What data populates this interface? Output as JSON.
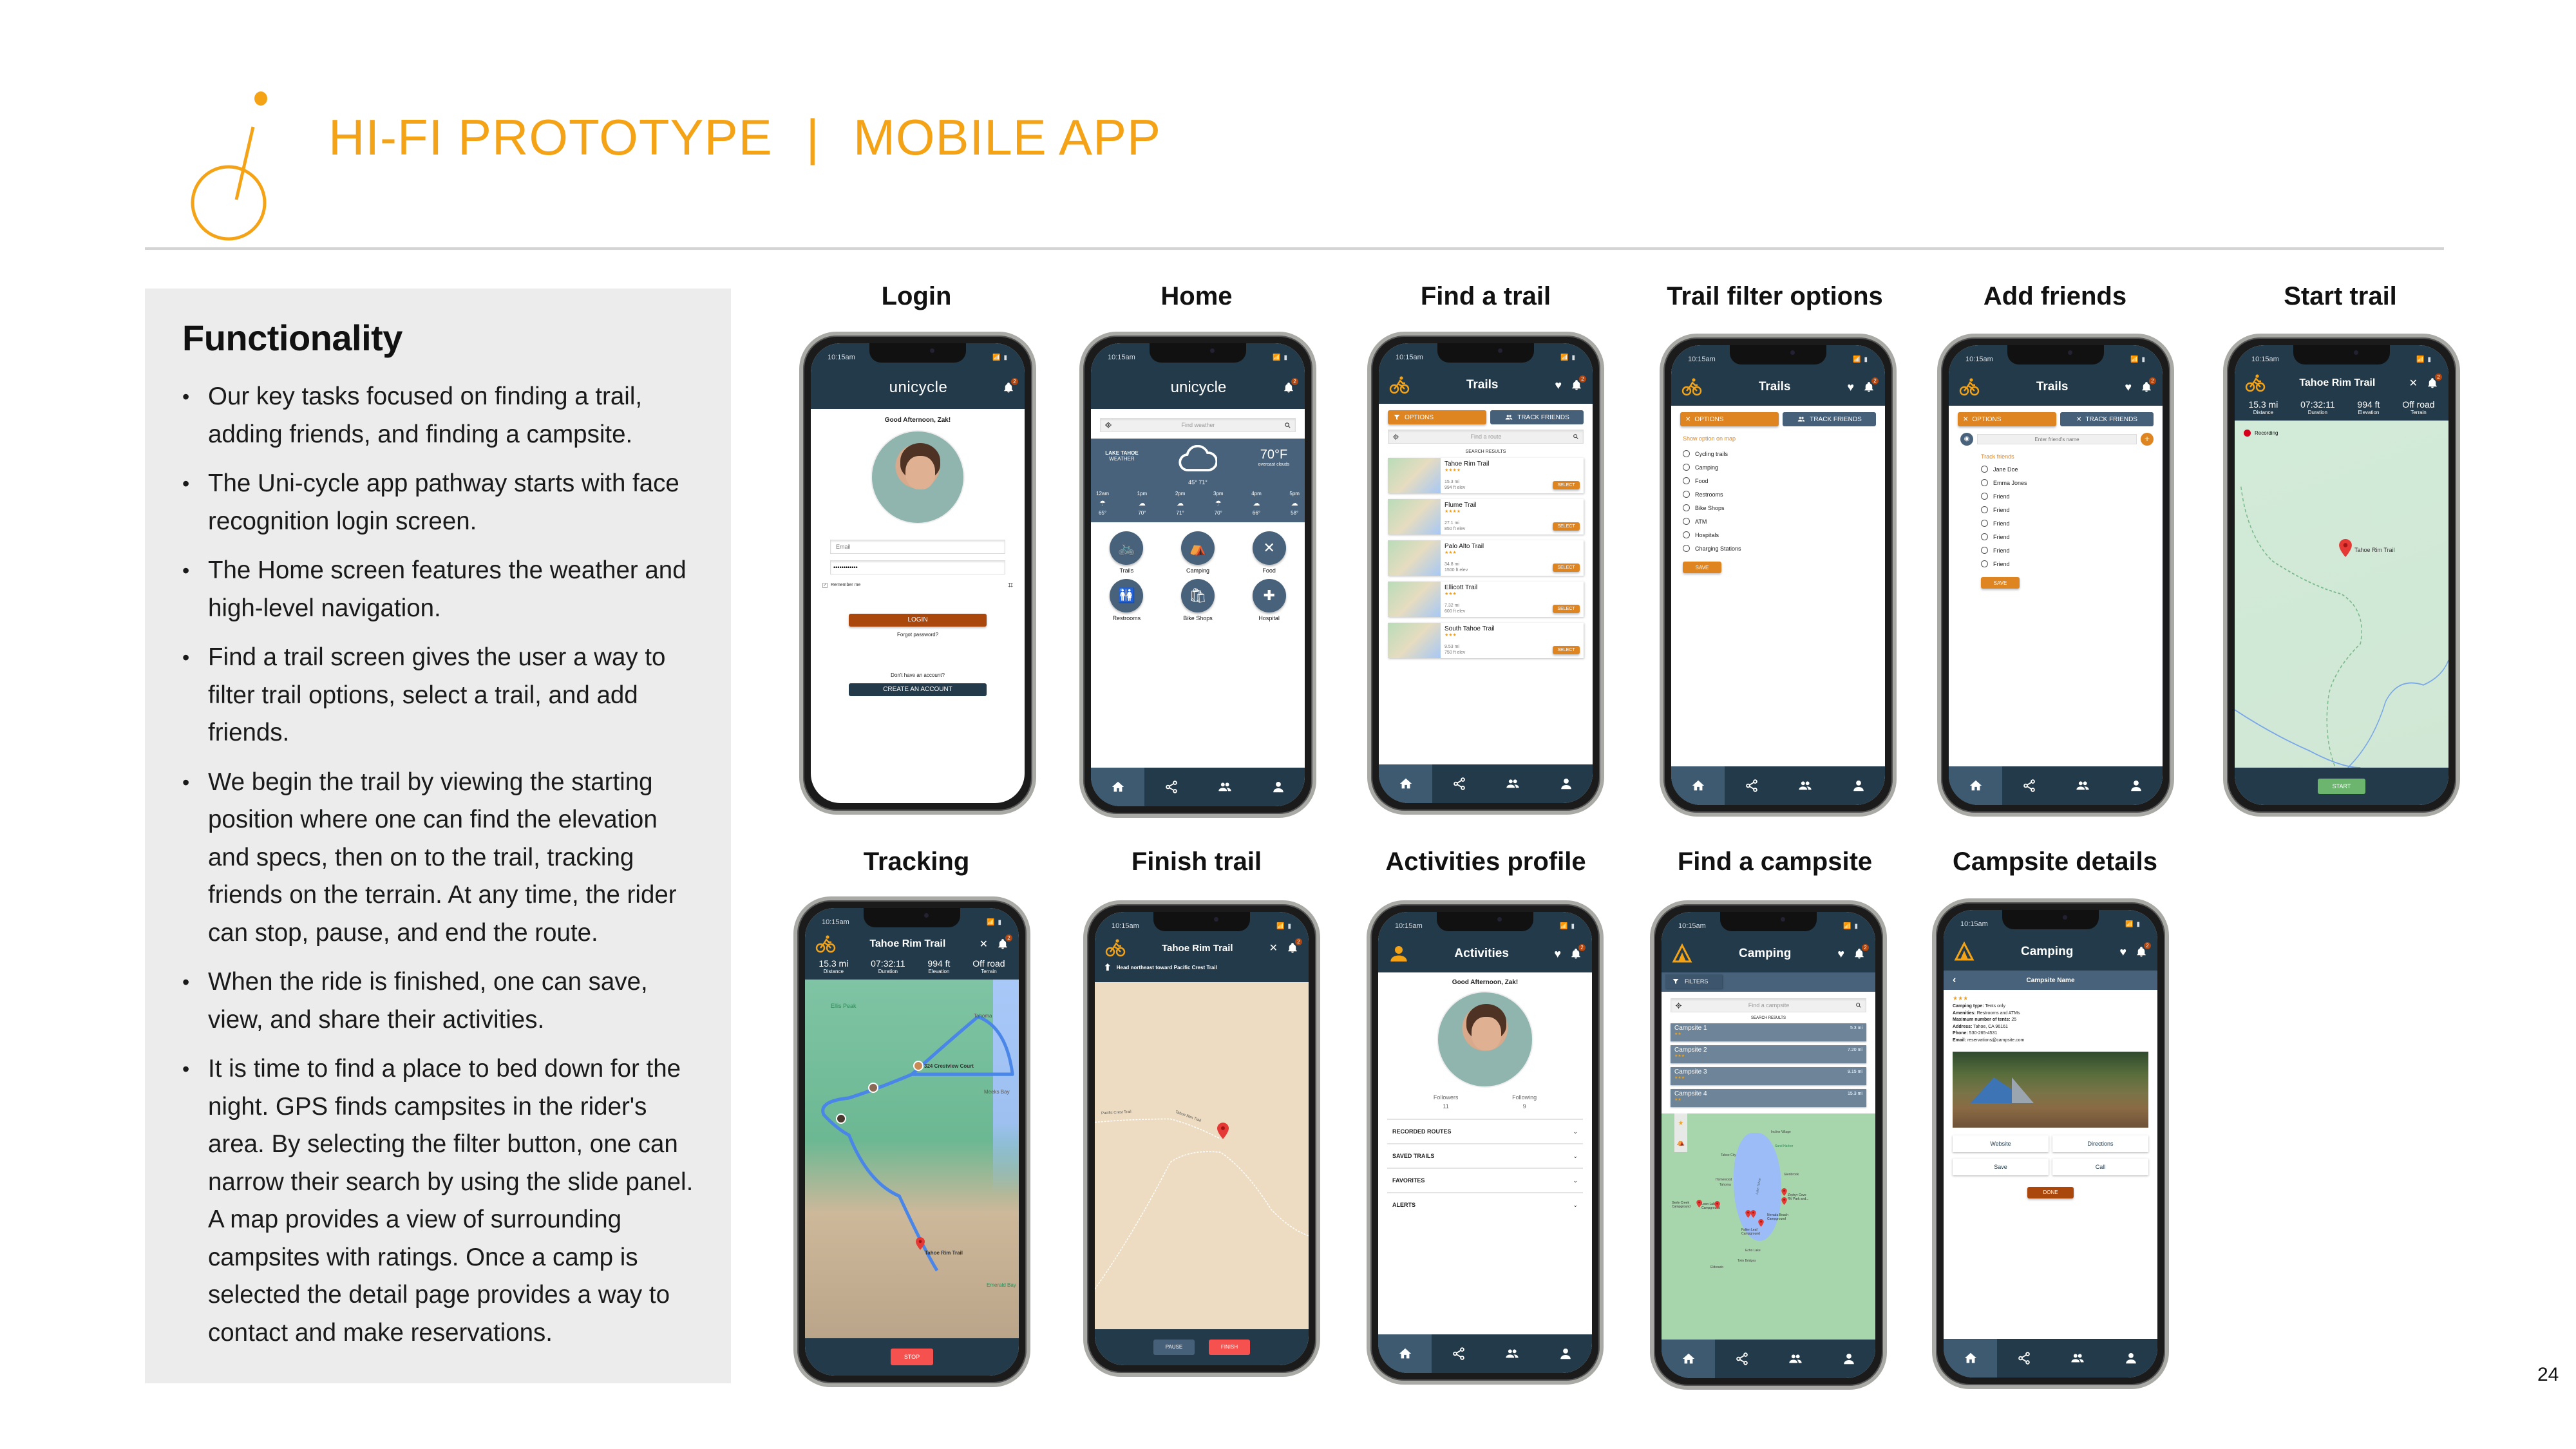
{
  "slide": {
    "title_left": "HI-FI PROTOTYPE",
    "title_sep": "|",
    "title_right": "MOBILE APP",
    "page_number": "24",
    "accent_color": "#f5a316"
  },
  "panel": {
    "heading": "Functionality",
    "bullets": [
      "Our key tasks focused on finding a trail, adding friends, and finding a campsite.",
      "The Uni-cycle app pathway starts with face recognition login screen.",
      "The Home screen features the weather and high-level navigation.",
      "Find a trail screen gives the user a way to filter trail options, select a trail, and add friends.",
      "We begin the trail by viewing the starting position where one can find the elevation and specs, then on to the trail, tracking friends on the terrain. At any time, the rider can stop, pause, and end the route.",
      "When the ride is finished, one can save, view, and share their activities.",
      "It is time to find a place to bed down for the night. GPS finds campsites in the rider's area. By selecting the filter button, one can narrow their search by using the slide panel. A map provides a view of surrounding campsites with ratings. Once a camp is selected the detail page provides a way to contact and make reservations."
    ]
  },
  "common": {
    "time": "10:15am",
    "badge_count": "2",
    "brand_prefix": "uni",
    "brand_suffix": "cycle",
    "colors": {
      "header": "#223a4a",
      "slate": "#47627a",
      "orange": "#de8420",
      "rust": "#a9470d",
      "red": "#f4514f",
      "green": "#6bb56f"
    }
  },
  "screens": {
    "login": {
      "label": "Login",
      "greeting": "Good Afternoon, Zak!",
      "email_placeholder": "Email",
      "password_value": "••••••••••••",
      "remember_me": "Remember me",
      "login_button": "LOGIN",
      "forgot": "Forgot password?",
      "no_account": "Don't have an account?",
      "create_button": "CREATE AN ACCOUNT"
    },
    "home": {
      "label": "Home",
      "search_placeholder": "Find weather",
      "location_line1": "LAKE TAHOE",
      "location_line2": "WEATHER",
      "temp": "70°F",
      "condition": "overcast clouds",
      "low_high": "45°  71°",
      "hours": [
        {
          "t": "12am",
          "icon": "rain",
          "v": "65°"
        },
        {
          "t": "1pm",
          "icon": "cloud",
          "v": "70°"
        },
        {
          "t": "2pm",
          "icon": "cloud",
          "v": "71°"
        },
        {
          "t": "3pm",
          "icon": "rain",
          "v": "70°"
        },
        {
          "t": "4pm",
          "icon": "cloud",
          "v": "66°"
        },
        {
          "t": "5pm",
          "icon": "cloud",
          "v": "58°"
        }
      ],
      "tiles": [
        {
          "label": "Trails",
          "icon": "bike-icon",
          "glyph": "🚲"
        },
        {
          "label": "Camping",
          "icon": "tent-icon",
          "glyph": "⛺"
        },
        {
          "label": "Food",
          "icon": "utensils-icon",
          "glyph": "✕"
        },
        {
          "label": "Restrooms",
          "icon": "restroom-icon",
          "glyph": "🚻"
        },
        {
          "label": "Bike Shops",
          "icon": "shopping-bag-icon",
          "glyph": "🛍"
        },
        {
          "label": "Hospital",
          "icon": "hospital-icon",
          "glyph": "✚"
        }
      ]
    },
    "find_trail": {
      "label": "Find a trail",
      "title": "Trails",
      "options_button": "OPTIONS",
      "track_button": "TRACK FRIENDS",
      "search_placeholder": "Find a route",
      "results_heading": "SEARCH RESULTS",
      "select_label": "SELECT",
      "trails": [
        {
          "name": "Tahoe Rim Trail",
          "stars": "★★★★",
          "dist": "15.3 mi",
          "elev": "994 ft elev"
        },
        {
          "name": "Flume Trail",
          "stars": "★★★★",
          "dist": "27.1 mi",
          "elev": "850 ft elev"
        },
        {
          "name": "Palo Alto Trail",
          "stars": "★★★",
          "dist": "34.8 mi",
          "elev": "1500 ft elev"
        },
        {
          "name": "Ellicott Trail",
          "stars": "★★★",
          "dist": "7.32 mi",
          "elev": "600 ft elev"
        },
        {
          "name": "South Tahoe Trail",
          "stars": "★★★",
          "dist": "9.53 mi",
          "elev": "750 ft elev"
        }
      ]
    },
    "trail_filter": {
      "label": "Trail filter options",
      "title": "Trails",
      "options_button": "OPTIONS",
      "track_button": "TRACK FRIENDS",
      "heading": "Show option on map",
      "options": [
        "Cycling trails",
        "Camping",
        "Food",
        "Restrooms",
        "Bike Shops",
        "ATM",
        "Hospitals",
        "Charging Stations"
      ],
      "save_button": "SAVE"
    },
    "add_friends": {
      "label": "Add friends",
      "title": "Trails",
      "options_button": "OPTIONS",
      "track_button": "TRACK FRIENDS",
      "friend_placeholder": "Enter friend's name",
      "heading": "Track friends",
      "friends": [
        "Jane Doe",
        "Emma Jones",
        "Friend",
        "Friend",
        "Friend",
        "Friend",
        "Friend",
        "Friend"
      ],
      "save_button": "SAVE"
    },
    "start_trail": {
      "label": "Start trail",
      "title": "Tahoe Rim Trail",
      "stats": [
        {
          "v": "15.3 mi",
          "l": "Distance"
        },
        {
          "v": "07:32:11",
          "l": "Duration"
        },
        {
          "v": "994 ft",
          "l": "Elevation"
        },
        {
          "v": "Off road",
          "l": "Terrain"
        }
      ],
      "recording": "Recording",
      "pin_label": "Tahoe Rim Trail",
      "start_button": "START"
    },
    "tracking": {
      "label": "Tracking",
      "title": "Tahoe Rim Trail",
      "stats": [
        {
          "v": "15.3 mi",
          "l": "Distance"
        },
        {
          "v": "07:32:11",
          "l": "Duration"
        },
        {
          "v": "994 ft",
          "l": "Elevation"
        },
        {
          "v": "Off road",
          "l": "Terrain"
        }
      ],
      "map_labels": [
        "Ellis Peak",
        "Tahoma",
        "324 Crestview Court",
        "Meeks Bay",
        "Tahoe Rim Trail",
        "Emerald Bay"
      ],
      "stop_button": "STOP"
    },
    "finish_trail": {
      "label": "Finish trail",
      "title": "Tahoe Rim Trail",
      "direction": "Head northeast toward Pacific Crest Trail",
      "map_labels": [
        "Pacific Crest Trail",
        "Tahoe Rim Trail"
      ],
      "pause_button": "PAUSE",
      "finish_button": "FINISH"
    },
    "activities": {
      "label": "Activities profile",
      "title": "Activities",
      "greeting": "Good Afternoon, Zak!",
      "followers_label": "Followers",
      "followers": "11",
      "following_label": "Following",
      "following": "9",
      "sections": [
        "RECORDED ROUTES",
        "SAVED TRAILS",
        "FAVORITES",
        "ALERTS"
      ]
    },
    "find_campsite": {
      "label": "Find a campsite",
      "title": "Camping",
      "filters_button": "FILTERS",
      "search_placeholder": "Find a campsite",
      "results_heading": "SEARCH RESULTS",
      "campsites": [
        {
          "name": "Campsite 1",
          "dist": "5.3 mi",
          "stars": "★★"
        },
        {
          "name": "Campsite 2",
          "dist": "7.20 mi",
          "stars": "★★★"
        },
        {
          "name": "Campsite 3",
          "dist": "9.15 mi",
          "stars": "★★★"
        },
        {
          "name": "Campsite 4",
          "dist": "15.3 mi",
          "stars": "★★"
        }
      ],
      "map_labels": [
        "Lake Tahoe",
        "Tahoe City",
        "Incline Village",
        "Sand Harbor",
        "Homewood",
        "Tahoma",
        "Glenbrook",
        "Gerle Creek Campground",
        "Loon Lake Campground",
        "Zephyr Cove RV Park and...",
        "Nevada Beach Campground",
        "Fallen Leaf Campground",
        "Echo Lake",
        "Twin Bridges",
        "Eldorado"
      ]
    },
    "campsite_details": {
      "label": "Campsite details",
      "title": "Camping",
      "subheader": "Campsite Name",
      "stars": "★★★",
      "fields": [
        {
          "k": "Camping type:",
          "v": " Tents only"
        },
        {
          "k": "Amenities:",
          "v": " Restrooms and ATMs"
        },
        {
          "k": "Maximum number of tents:",
          "v": " 25"
        },
        {
          "k": "Address:",
          "v": " Tahoe, CA 96161"
        },
        {
          "k": "Phone:",
          "v": " 530-265-4531"
        },
        {
          "k": "Email:",
          "v": " reservations@campsite.com"
        }
      ],
      "buttons": [
        "Website",
        "Directions",
        "Save",
        "Call"
      ],
      "done_button": "DONE"
    }
  }
}
